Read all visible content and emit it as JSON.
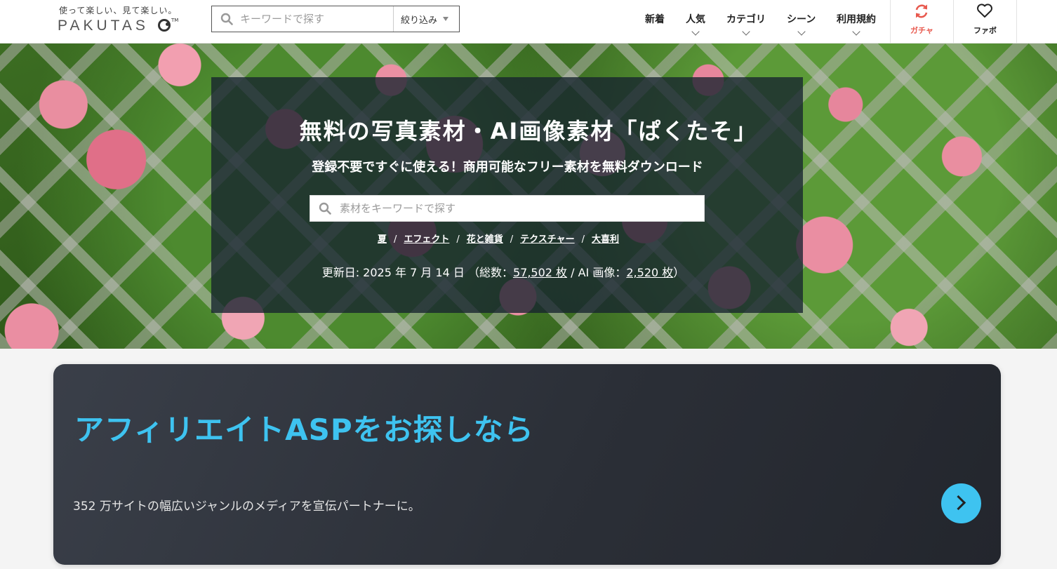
{
  "header": {
    "logo_tagline": "使って楽しい、見て楽しい。",
    "logo_word": "PAKUTAS",
    "logo_tm": "TM",
    "search_placeholder": "キーワードで探す",
    "filter_label": "絞り込み",
    "nav": [
      {
        "label": "新着",
        "has_dropdown": false
      },
      {
        "label": "人気",
        "has_dropdown": true
      },
      {
        "label": "カテゴリ",
        "has_dropdown": true
      },
      {
        "label": "シーン",
        "has_dropdown": true
      },
      {
        "label": "利用規約",
        "has_dropdown": true
      }
    ],
    "gacha": {
      "label": "ガチャ",
      "icon": "refresh-icon",
      "color": "#e8594e"
    },
    "favorite": {
      "label": "ファボ",
      "icon": "heart-icon"
    }
  },
  "hero": {
    "title": "無料の写真素材・AI画像素材「ぱくたそ」",
    "subtitle": "登録不要ですぐに使える！商用可能なフリー素材を無料ダウンロード",
    "search_placeholder": "素材をキーワードで探す",
    "tags": [
      "夏",
      "エフェクト",
      "花と雑貨",
      "テクスチャー",
      "大喜利"
    ],
    "tag_separator": "/",
    "updated_prefix": "更新日: 2025 年 7 月 14 日 （総数：",
    "total_count": "57,502 枚",
    "ai_prefix": " / AI 画像：",
    "ai_count": "2,520 枚",
    "updated_suffix": "）"
  },
  "banner": {
    "title": "アフィリエイトASPをお探しなら",
    "text": "352 万サイトの幅広いジャンルのメディアを宣伝パートナーに。",
    "accent_color": "#3ec3f0",
    "arrow_icon": "chevron-right-icon"
  }
}
